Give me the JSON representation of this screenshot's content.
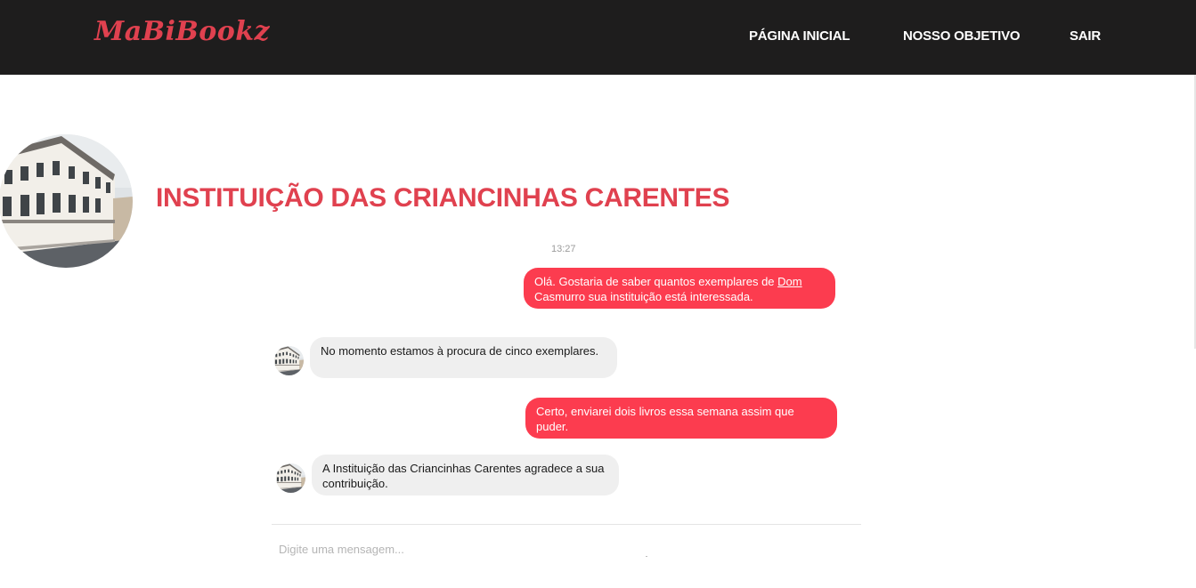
{
  "header": {
    "logo": "MaBiBookz",
    "nav": {
      "home": "PÁGINA INICIAL",
      "goal": "NOSSO OBJETIVO",
      "exit": "SAIR"
    }
  },
  "institution": {
    "name": "INSTITUIÇÃO DAS CRIANCINHAS CARENTES"
  },
  "chat": {
    "timestamp": "13:27",
    "messages": [
      {
        "from": "user",
        "text_before": "Olá. Gostaria de saber quantos exemplares de ",
        "link": "Dom",
        "text_after": " Casmurro sua instituição está interessada."
      },
      {
        "from": "institution",
        "text": "No momento estamos à procura de cinco exemplares."
      },
      {
        "from": "user",
        "text": "Certo, enviarei dois livros essa semana assim que puder."
      },
      {
        "from": "institution",
        "text": "A Instituição das Criancinhas Carentes  agradece a sua contribuição."
      }
    ],
    "input_placeholder": "Digite uma mensagem..."
  },
  "colors": {
    "brand": "#e0414f",
    "sent_bubble": "#fc3c4f",
    "received_bubble": "#efefef",
    "topbar": "#1e1d1d"
  }
}
